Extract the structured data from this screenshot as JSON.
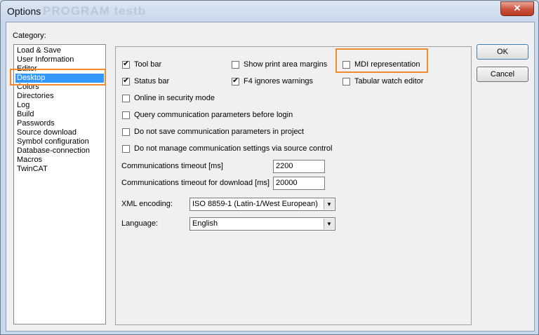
{
  "window": {
    "title": "Options",
    "title_ghost": "PROGRAM testb",
    "close_glyph": "✕"
  },
  "category": {
    "label": "Category:",
    "items": [
      "Load & Save",
      "User Information",
      "Editor",
      "Desktop",
      "Colors",
      "Directories",
      "Log",
      "Build",
      "Passwords",
      "Source download",
      "Symbol configuration",
      "Database-connection",
      "Macros",
      "TwinCAT"
    ],
    "selected": "Desktop"
  },
  "options": {
    "tool_bar": {
      "label": "Tool bar",
      "checked": true
    },
    "status_bar": {
      "label": "Status bar",
      "checked": true
    },
    "online_security": {
      "label": "Online in security mode",
      "checked": false
    },
    "query_comm": {
      "label": "Query communication parameters before login",
      "checked": false
    },
    "no_save_comm": {
      "label": "Do not save communication parameters in project",
      "checked": false
    },
    "no_manage_comm": {
      "label": "Do not manage communication settings via source control",
      "checked": false
    },
    "show_print_margins": {
      "label": "Show print area margins",
      "checked": false
    },
    "f4_ignores": {
      "label": "F4 ignores warnings",
      "checked": true
    },
    "mdi": {
      "label": "MDI representation",
      "checked": false
    },
    "tabular_watch": {
      "label": "Tabular watch editor",
      "checked": false
    }
  },
  "timeouts": {
    "comm_label": "Communications timeout [ms]",
    "comm_value": "2200",
    "download_label": "Communications timeout for download [ms]",
    "download_value": "20000"
  },
  "xml": {
    "label": "XML encoding:",
    "value": "ISO 8859-1 (Latin-1/West European)"
  },
  "language": {
    "label": "Language:",
    "value": "English"
  },
  "buttons": {
    "ok": "OK",
    "cancel": "Cancel"
  },
  "colors": {
    "highlight": "#f08a2e",
    "selection": "#3399ff"
  }
}
